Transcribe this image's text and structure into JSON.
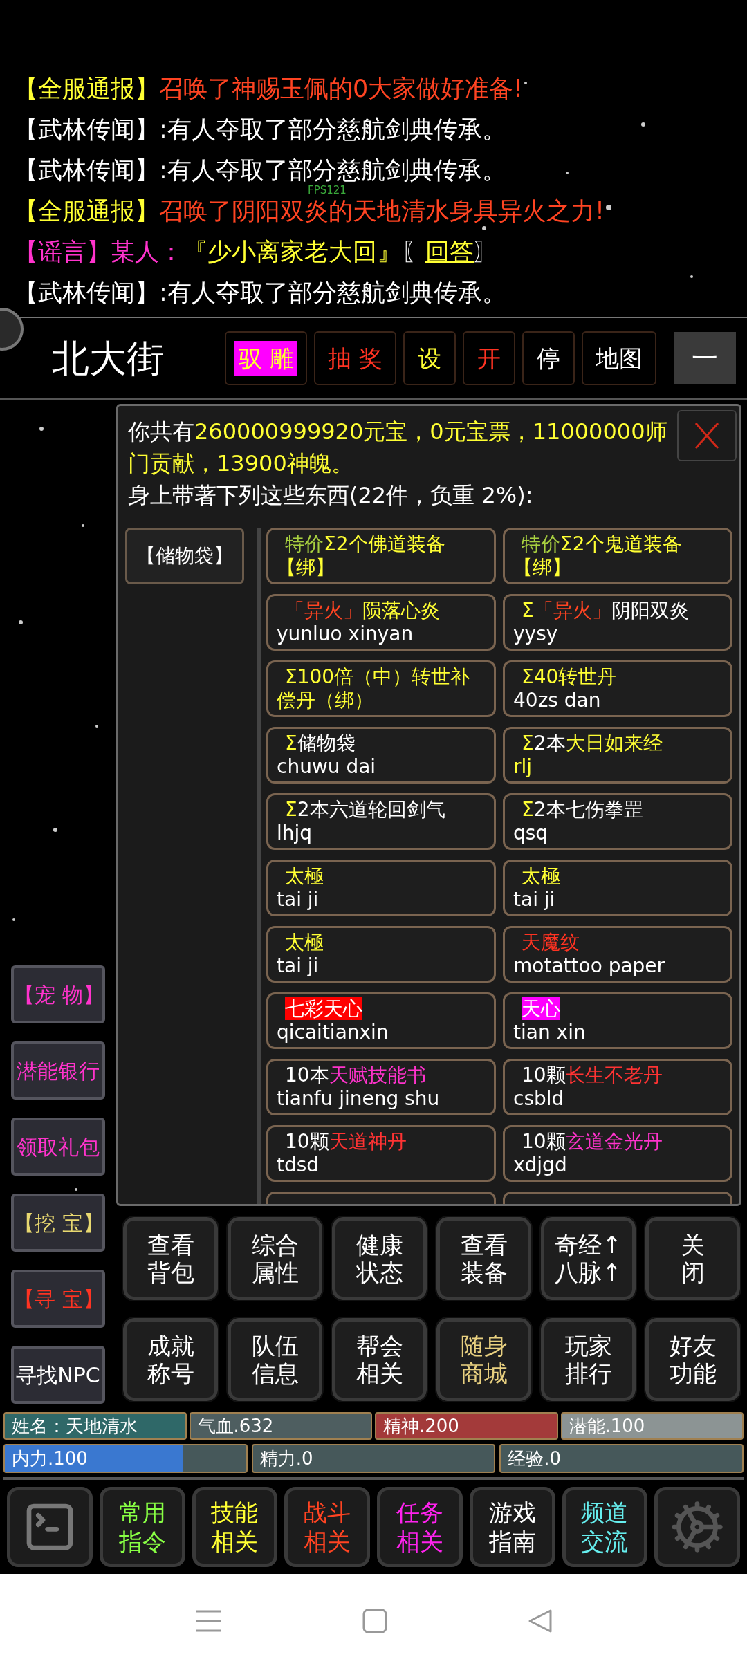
{
  "chat": [
    {
      "segments": [
        {
          "text": "【全服通报】",
          "color": "#ffff33"
        },
        {
          "text": "召唤了神赐玉佩的0大家做好准备!",
          "color": "#ff4422"
        }
      ]
    },
    {
      "segments": [
        {
          "text": "【武林传闻】:有人夺取了部分慈航剑典传承。",
          "color": "#ffffff"
        }
      ]
    },
    {
      "segments": [
        {
          "text": "【武林传闻】:有人夺取了部分慈航剑典传承。",
          "color": "#ffffff"
        }
      ]
    },
    {
      "segments": [
        {
          "text": "【全服通报】",
          "color": "#ffff33"
        },
        {
          "text": "召唤了阴阳双炎的天地清水身具异火之力!",
          "color": "#ff4422"
        }
      ]
    },
    {
      "segments": [
        {
          "kind": "text",
          "text": "【谣言】某人：",
          "color": "#ff33cc"
        },
        {
          "kind": "text",
          "text": "『少小离家老大回』",
          "color": "#ffff33"
        },
        {
          "kind": "text",
          "text": "〖",
          "color": "#ffffff"
        },
        {
          "kind": "link",
          "text": "回答",
          "color": "#ffff33"
        },
        {
          "kind": "text",
          "text": "〗",
          "color": "#ffffff"
        }
      ]
    },
    {
      "segments": [
        {
          "text": "【武林传闻】:有人夺取了部分慈航剑典传承。",
          "color": "#ffffff"
        }
      ]
    }
  ],
  "fps": "FPS121",
  "location": "北大街",
  "actions": [
    {
      "kind": "tag",
      "label": "驭 雕",
      "color": "#ffff33",
      "highlight": {
        "color": "#ff00ff"
      }
    },
    {
      "kind": "tag",
      "label": "抽 奖",
      "color": "#ff3322"
    },
    {
      "kind": "tag",
      "label": "设",
      "color": "#ffff33"
    },
    {
      "kind": "tag",
      "label": "开",
      "color": "#ff3322"
    },
    {
      "kind": "tag",
      "label": "停",
      "color": "#ffffff"
    },
    {
      "kind": "tag",
      "label": "地图",
      "color": "#ffffff"
    },
    {
      "kind": "square",
      "label": "一",
      "color": "#ffffff"
    }
  ],
  "sidebar": [
    {
      "label": "【宠 物】",
      "color": "#ff33cc"
    },
    {
      "label": "潜能银行",
      "color": "#ff33cc"
    },
    {
      "label": "领取礼包",
      "color": "#ff33cc"
    },
    {
      "label": "【挖 宝】",
      "color": "#e8d870"
    },
    {
      "label": "【寻 宝】",
      "color": "#ff3322"
    },
    {
      "label": "寻找NPC",
      "color": "#ffffff"
    }
  ],
  "inventory": {
    "balance": [
      {
        "text": "你共有",
        "color": "#ffffff"
      },
      {
        "text": "260000999920元宝，0元宝票，11000000师门贡献，13900神魄。",
        "color": "#ffff33"
      }
    ],
    "summary": "身上带著下列这些东西(22件，负重 2%):",
    "category": "【储物袋】",
    "items": [
      {
        "name": [
          {
            "text": "特价",
            "color": "#a8d040"
          },
          {
            "text": "Σ2个佛道装备",
            "color": "#ffff33"
          }
        ],
        "code": {
          "text": "【绑】",
          "color": "#ffff33"
        }
      },
      {
        "name": [
          {
            "text": "特价",
            "color": "#a8d040"
          },
          {
            "text": "Σ2个鬼道装备",
            "color": "#ffff33"
          }
        ],
        "code": {
          "text": "【绑】",
          "color": "#ffff33"
        }
      },
      {
        "name": [
          {
            "text": "「异火」",
            "color": "#ff4422"
          },
          {
            "text": "陨落心炎",
            "color": "#ffff33"
          }
        ],
        "code": {
          "text": "yunluo xinyan",
          "color": "#ffffff"
        }
      },
      {
        "name": [
          {
            "text": "Σ",
            "color": "#ffff33"
          },
          {
            "text": "「异火」",
            "color": "#ff4422"
          },
          {
            "text": "阴阳双炎",
            "color": "#ffffff"
          }
        ],
        "code": {
          "text": "yysy",
          "color": "#ffffff"
        }
      },
      {
        "name": [
          {
            "text": "Σ100倍（中）转世补偿丹（绑）",
            "color": "#ffff33"
          }
        ]
      },
      {
        "name": [
          {
            "text": "Σ40转世丹",
            "color": "#ffff33"
          }
        ],
        "code": {
          "text": "40zs dan",
          "color": "#ffffff"
        }
      },
      {
        "name": [
          {
            "text": "Σ",
            "color": "#ffff33"
          },
          {
            "text": "储物袋",
            "color": "#ffffff"
          }
        ],
        "code": {
          "text": "chuwu dai",
          "color": "#ffffff"
        }
      },
      {
        "name": [
          {
            "text": "Σ",
            "color": "#ffff33"
          },
          {
            "text": "2本",
            "color": "#ffffff"
          },
          {
            "text": "大日如来经",
            "color": "#ffff33"
          }
        ],
        "code": {
          "text": "rlj",
          "color": "#ffff33"
        }
      },
      {
        "name": [
          {
            "text": "Σ",
            "color": "#ffff33"
          },
          {
            "text": "2本六道轮回剑气",
            "color": "#ffffff"
          }
        ],
        "code": {
          "text": "lhjq",
          "color": "#ffffff"
        }
      },
      {
        "name": [
          {
            "text": "Σ",
            "color": "#ffff33"
          },
          {
            "text": "2本七伤拳罡",
            "color": "#ffffff"
          }
        ],
        "code": {
          "text": "qsq",
          "color": "#ffffff"
        }
      },
      {
        "name": [
          {
            "text": "太極",
            "color": "#ffff33"
          }
        ],
        "code": {
          "text": "tai ji",
          "color": "#ffffff"
        }
      },
      {
        "name": [
          {
            "text": "太極",
            "color": "#ffff33"
          }
        ],
        "code": {
          "text": "tai ji",
          "color": "#ffffff"
        }
      },
      {
        "name": [
          {
            "text": "太極",
            "color": "#ffff33"
          }
        ],
        "code": {
          "text": "tai ji",
          "color": "#ffffff"
        }
      },
      {
        "name": [
          {
            "text": "天魔纹",
            "color": "#ff3322"
          }
        ],
        "code": {
          "text": "motattoo paper",
          "color": "#ffffff"
        }
      },
      {
        "name": [
          {
            "text": "七彩天心",
            "highlight": {
              "color": "#ff0000"
            }
          }
        ],
        "code": {
          "text": "qicaitianxin",
          "color": "#ffffff"
        }
      },
      {
        "name": [
          {
            "text": "天心",
            "highlight": {
              "color": "#ff00ff"
            }
          }
        ],
        "code": {
          "text": "tian xin",
          "color": "#ffffff"
        }
      },
      {
        "name": [
          {
            "text": "10本",
            "color": "#ffffff"
          },
          {
            "text": "天赋技能书",
            "color": "#ff33cc"
          }
        ],
        "code": {
          "text": "tianfu jineng shu",
          "color": "#ffffff"
        }
      },
      {
        "name": [
          {
            "text": "10颗",
            "color": "#ffffff"
          },
          {
            "text": "长生不老丹",
            "color": "#ff3333"
          }
        ],
        "code": {
          "text": "csbld",
          "color": "#ffffff"
        }
      },
      {
        "name": [
          {
            "text": "10颗",
            "color": "#ffffff"
          },
          {
            "text": "天道神丹",
            "color": "#ff3333"
          }
        ],
        "code": {
          "text": "tdsd",
          "color": "#ffffff"
        }
      },
      {
        "name": [
          {
            "text": "10颗",
            "color": "#ffffff"
          },
          {
            "text": "玄道金光丹",
            "color": "#ff33cc"
          }
        ],
        "code": {
          "text": "xdjgd",
          "color": "#ffffff"
        }
      }
    ]
  },
  "commands": [
    {
      "lines": [
        "查看",
        "背包"
      ],
      "color": "#ffffff"
    },
    {
      "lines": [
        "综合",
        "属性"
      ],
      "color": "#ffffff"
    },
    {
      "lines": [
        "健康",
        "状态"
      ],
      "color": "#ffffff"
    },
    {
      "lines": [
        "查看",
        "装备"
      ],
      "color": "#ffffff"
    },
    {
      "lines": [
        "奇经↑",
        "八脉↑"
      ],
      "color": "#ffffff"
    },
    {
      "lines": [
        "关",
        "闭"
      ],
      "color": "#ffffff"
    },
    {
      "lines": [
        "成就",
        "称号"
      ],
      "color": "#ffffff"
    },
    {
      "lines": [
        "队伍",
        "信息"
      ],
      "color": "#ffffff"
    },
    {
      "lines": [
        "帮会",
        "相关"
      ],
      "color": "#ffffff"
    },
    {
      "lines": [
        "随身",
        "商城"
      ],
      "color": "#e8d080"
    },
    {
      "lines": [
        "玩家",
        "排行"
      ],
      "color": "#ffffff"
    },
    {
      "lines": [
        "好友",
        "功能"
      ],
      "color": "#ffffff"
    }
  ],
  "stats": [
    {
      "label": "姓名：天地清水",
      "color": "#2f6868"
    },
    {
      "label": "气血.632",
      "color": "#4e5e60"
    },
    {
      "label": "精神.200",
      "color": "#a33a3a"
    },
    {
      "label": "潜能.100",
      "color": "#8c9494"
    }
  ],
  "meters": [
    {
      "label": "内力.100",
      "level": 0.74
    },
    {
      "label": "精力.0",
      "level": 0
    },
    {
      "label": "经验.0",
      "level": 0
    }
  ],
  "toolbar": [
    {
      "kind": "terminal"
    },
    {
      "kind": "text",
      "lines": [
        "常用",
        "指令"
      ],
      "color": "#88ff44"
    },
    {
      "kind": "text",
      "lines": [
        "技能",
        "相关"
      ],
      "color": "#ffff33"
    },
    {
      "kind": "text",
      "lines": [
        "战斗",
        "相关"
      ],
      "color": "#ff4422"
    },
    {
      "kind": "text",
      "lines": [
        "任务",
        "相关"
      ],
      "color": "#ff22ee"
    },
    {
      "kind": "text",
      "lines": [
        "游戏",
        "指南"
      ],
      "color": "#ffffff"
    },
    {
      "kind": "text",
      "lines": [
        "频道",
        "交流"
      ],
      "color": "#66eeee"
    },
    {
      "kind": "gear"
    }
  ]
}
